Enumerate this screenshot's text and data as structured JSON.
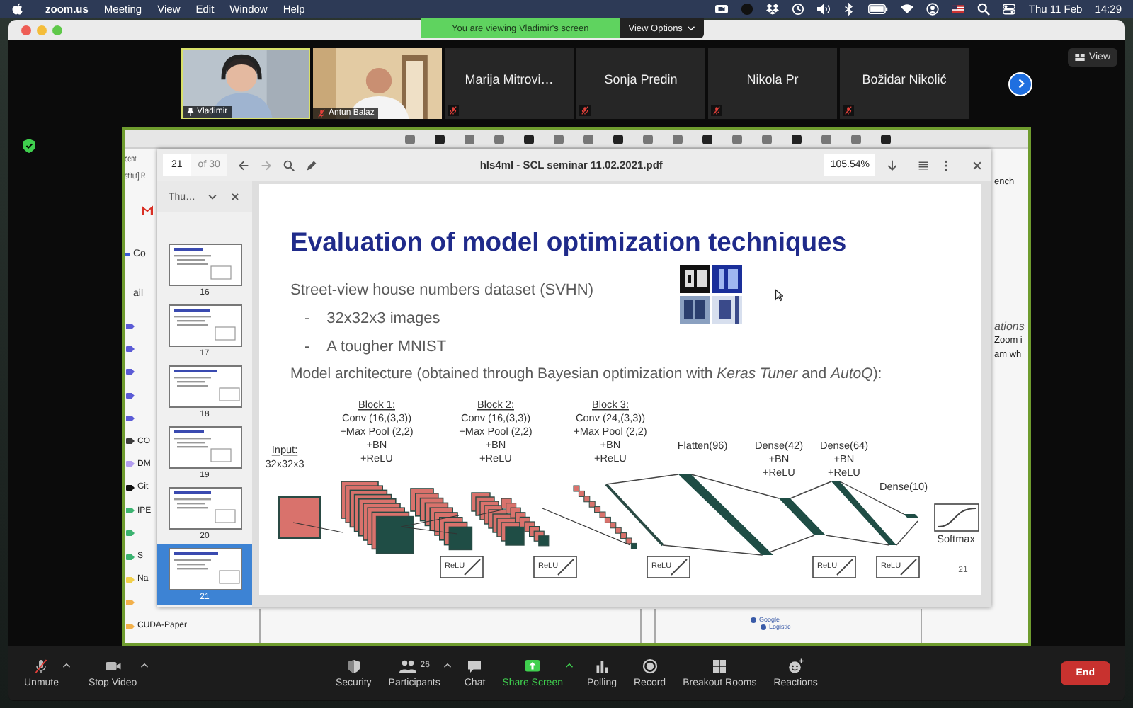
{
  "menu_bar": {
    "app_name": "zoom.us",
    "menus": [
      "Meeting",
      "View",
      "Edit",
      "Window",
      "Help"
    ],
    "date": "Thu 11 Feb",
    "time": "14:29"
  },
  "banner": {
    "message": "You are viewing Vladimir's screen",
    "options_label": "View Options"
  },
  "view_button": "View",
  "participants": [
    {
      "name": "Vladimir",
      "kind": "video",
      "selected": true,
      "pinned": true,
      "muted": false
    },
    {
      "name": "Antun Balaz",
      "kind": "video",
      "selected": false,
      "pinned": false,
      "muted": true
    },
    {
      "name": "Marija Mitrovi…",
      "kind": "name",
      "selected": false,
      "pinned": false,
      "muted": true
    },
    {
      "name": "Sonja Predin",
      "kind": "name",
      "selected": false,
      "pinned": false,
      "muted": true
    },
    {
      "name": "Nikola Pr",
      "kind": "name",
      "selected": false,
      "pinned": false,
      "muted": true
    },
    {
      "name": "Božidar Nikolić",
      "kind": "name",
      "selected": false,
      "pinned": false,
      "muted": true
    }
  ],
  "shared_screen": {
    "page_fragments": [
      "cent",
      "stitut] R"
    ],
    "sidebar_items": [
      "Co",
      "ail"
    ],
    "sidebar_labels": [
      {
        "color": "#5b5bd6"
      },
      {
        "color": "#5b5bd6"
      },
      {
        "color": "#5b5bd6"
      },
      {
        "color": "#5b5bd6"
      },
      {
        "color": "#5b5bd6"
      },
      {
        "text": "CO",
        "color": "#3a3a3a"
      },
      {
        "text": "DM",
        "color": "#b39ef0"
      },
      {
        "text": "Git",
        "color": "#111111"
      },
      {
        "text": "IPE",
        "color": "#3cb371"
      },
      {
        "color": "#3cb371"
      },
      {
        "text": "S",
        "color": "#3cb371"
      },
      {
        "text": "Na",
        "color": "#f2d04b"
      },
      {
        "color": "#f2b04b"
      },
      {
        "text": "CUDA-Paper",
        "color": "#f2b04b"
      }
    ],
    "right_fragments": [
      {
        "text": "ench",
        "italic": false
      },
      {
        "text": "ations",
        "italic": true
      },
      {
        "text": "Zoom i",
        "italic": false
      },
      {
        "text": "am wh",
        "italic": false
      }
    ],
    "legend": [
      "Google",
      "Logistic"
    ],
    "pdf_viewer": {
      "page": "21",
      "page_total": "of 30",
      "title": "hls4ml - SCL seminar 11.02.2021.pdf",
      "zoom": "105.54%",
      "thumbnails_header": "Thu…",
      "thumbnails": [
        {
          "number": "16",
          "selected": false
        },
        {
          "number": "17",
          "selected": false
        },
        {
          "number": "18",
          "selected": false
        },
        {
          "number": "19",
          "selected": false
        },
        {
          "number": "20",
          "selected": false
        },
        {
          "number": "21",
          "selected": true
        }
      ],
      "slide": {
        "title": "Evaluation of model optimization techniques",
        "lead": "Street-view house numbers dataset (SVHN)",
        "bullets": [
          {
            "marker": "-",
            "text": "32x32x3 images"
          },
          {
            "marker": "-",
            "text": "A tougher MNIST"
          }
        ],
        "architecture": "Model architecture (obtained through Bayesian optimization with *Keras Tuner* and *AutoQ*):",
        "input_label": "Input:",
        "input_shape": "32x32x3",
        "blocks": [
          {
            "title": "Block 1:",
            "lines": [
              "Conv (16,(3,3))",
              "+Max Pool (2,2)",
              "+BN",
              "+ReLU"
            ]
          },
          {
            "title": "Block 2:",
            "lines": [
              "Conv (16,(3,3))",
              "+Max Pool (2,2)",
              "+BN",
              "+ReLU"
            ]
          },
          {
            "title": "Block 3:",
            "lines": [
              "Conv (24,(3,3))",
              "+Max Pool (2,2)",
              "+BN",
              "+ReLU"
            ]
          }
        ],
        "layers": [
          {
            "title": "Flatten(96)"
          },
          {
            "title": "Dense(42)",
            "lines": [
              "+BN",
              "+ReLU"
            ]
          },
          {
            "title": "Dense(64)",
            "lines": [
              "+BN",
              "+ReLU"
            ]
          },
          {
            "title": "Dense(10)"
          }
        ],
        "activations": [
          "ReLU",
          "ReLU",
          "ReLU",
          "ReLU",
          "ReLU"
        ],
        "output": "Softmax",
        "page_number": "21"
      }
    }
  },
  "toolbar_left": [
    {
      "label": "Unmute",
      "kind": "mic",
      "caret": true
    },
    {
      "label": "Stop Video",
      "kind": "video",
      "caret": true
    }
  ],
  "toolbar_center": [
    {
      "label": "Security",
      "kind": "shield",
      "caret": false
    },
    {
      "label": "Participants",
      "kind": "people",
      "caret": true,
      "count": "26"
    },
    {
      "label": "Chat",
      "kind": "chat",
      "caret": false
    },
    {
      "label": "Share Screen",
      "kind": "share",
      "caret": true
    },
    {
      "label": "Polling",
      "kind": "poll",
      "caret": false
    },
    {
      "label": "Record",
      "kind": "record",
      "caret": false
    },
    {
      "label": "Breakout Rooms",
      "kind": "rooms",
      "caret": false
    },
    {
      "label": "Reactions",
      "kind": "reactions",
      "caret": false
    }
  ],
  "end_button": "End"
}
